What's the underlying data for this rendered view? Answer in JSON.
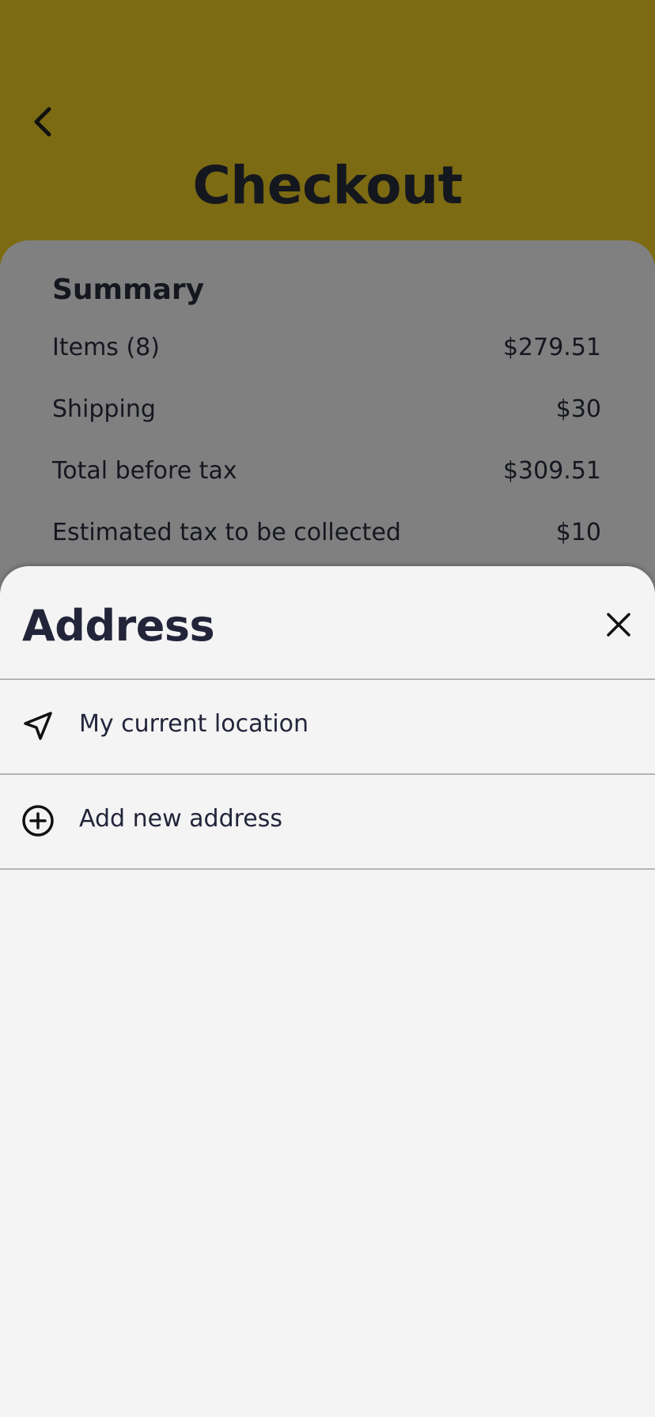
{
  "header": {
    "title": "Checkout",
    "background_color": "#7c6b12",
    "back_icon": "chevron-left-icon"
  },
  "summary": {
    "heading": "Summary",
    "rows": [
      {
        "label": "Items (8)",
        "value": "$279.51"
      },
      {
        "label": "Shipping",
        "value": "$30"
      },
      {
        "label": "Total before tax",
        "value": "$309.51"
      },
      {
        "label": "Estimated tax to be collected",
        "value": "$10"
      }
    ]
  },
  "address_sheet": {
    "title": "Address",
    "close_icon": "close-icon",
    "options": [
      {
        "label": "My current location",
        "icon": "navigation-arrow-icon"
      },
      {
        "label": "Add new address",
        "icon": "plus-circle-icon"
      }
    ]
  }
}
